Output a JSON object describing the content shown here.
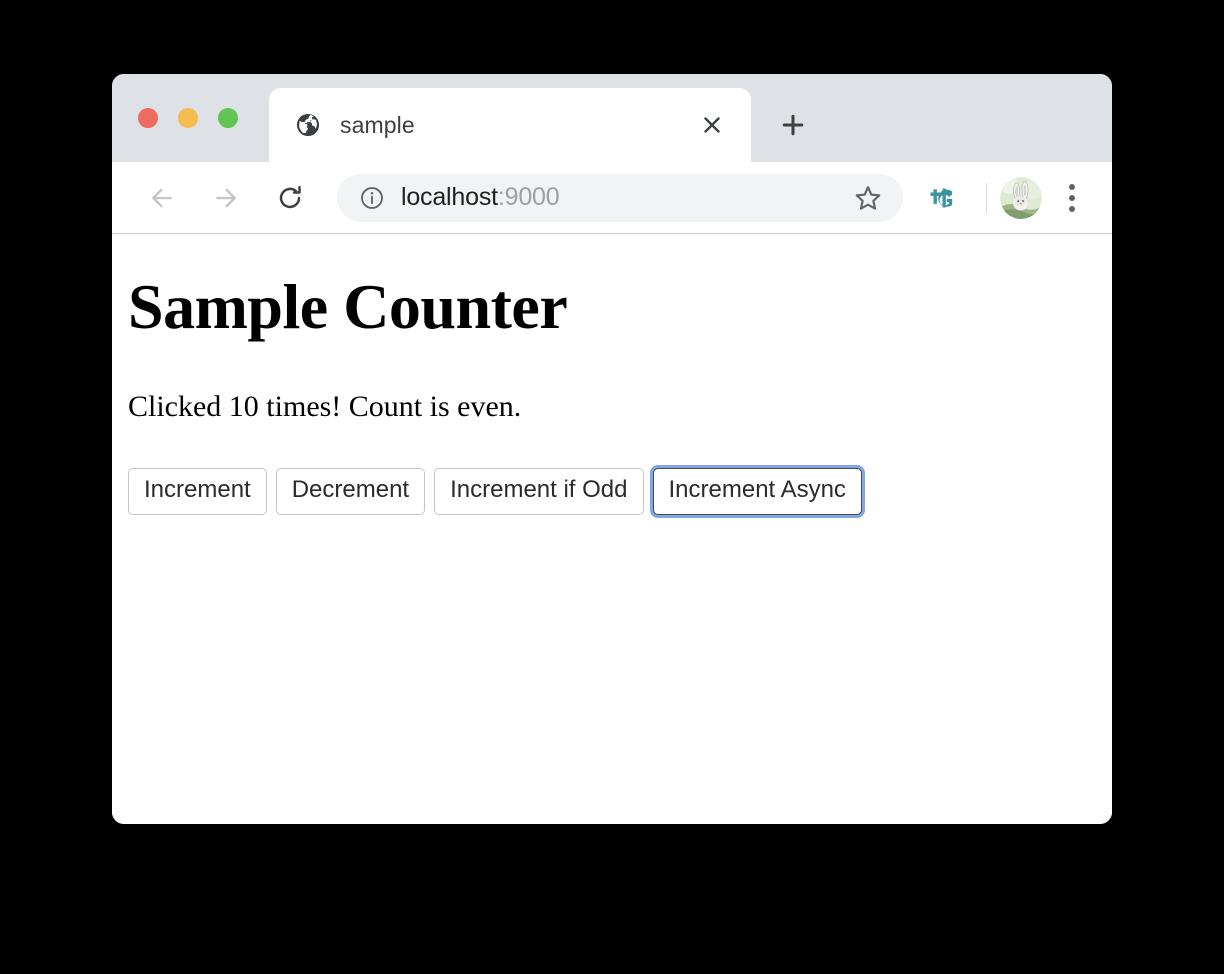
{
  "window": {
    "traffic_lights": [
      {
        "name": "close",
        "color": "#ed6b5f"
      },
      {
        "name": "minimize",
        "color": "#f5bd4f"
      },
      {
        "name": "maximize",
        "color": "#61c554"
      }
    ]
  },
  "tabstrip": {
    "tabs": [
      {
        "title": "sample",
        "favicon": "globe-icon",
        "active": true
      }
    ],
    "new_tab_label": "+",
    "close_tab_label": "×"
  },
  "toolbar": {
    "back_icon": "arrow-left-icon",
    "forward_icon": "arrow-right-icon",
    "reload_icon": "reload-icon",
    "info_icon": "info-circle-icon",
    "url_host": "localhost",
    "url_port": ":9000",
    "bookmark_icon": "star-outline-icon",
    "extension_icon": "extension-4g-logo-icon",
    "extension_label": "4G",
    "avatar_icon": "profile-avatar-rabbit",
    "menu_icon": "three-dot-menu-icon",
    "colors": {
      "omnibox_bg": "#f1f3f4",
      "tabstrip_bg": "#dee1e6",
      "extension_accent": "#3f93a0",
      "url_host_color": "#202124",
      "url_port_color": "#9aa0a6"
    }
  },
  "page": {
    "heading": "Sample Counter",
    "status_text": "Clicked 10 times! Count is even.",
    "count": 10,
    "parity": "even",
    "buttons": [
      {
        "label": "Increment",
        "focused": false
      },
      {
        "label": "Decrement",
        "focused": false
      },
      {
        "label": "Increment if Odd",
        "focused": false
      },
      {
        "label": "Increment Async",
        "focused": true
      }
    ],
    "focus_ring_color": "#7ea6e8"
  }
}
